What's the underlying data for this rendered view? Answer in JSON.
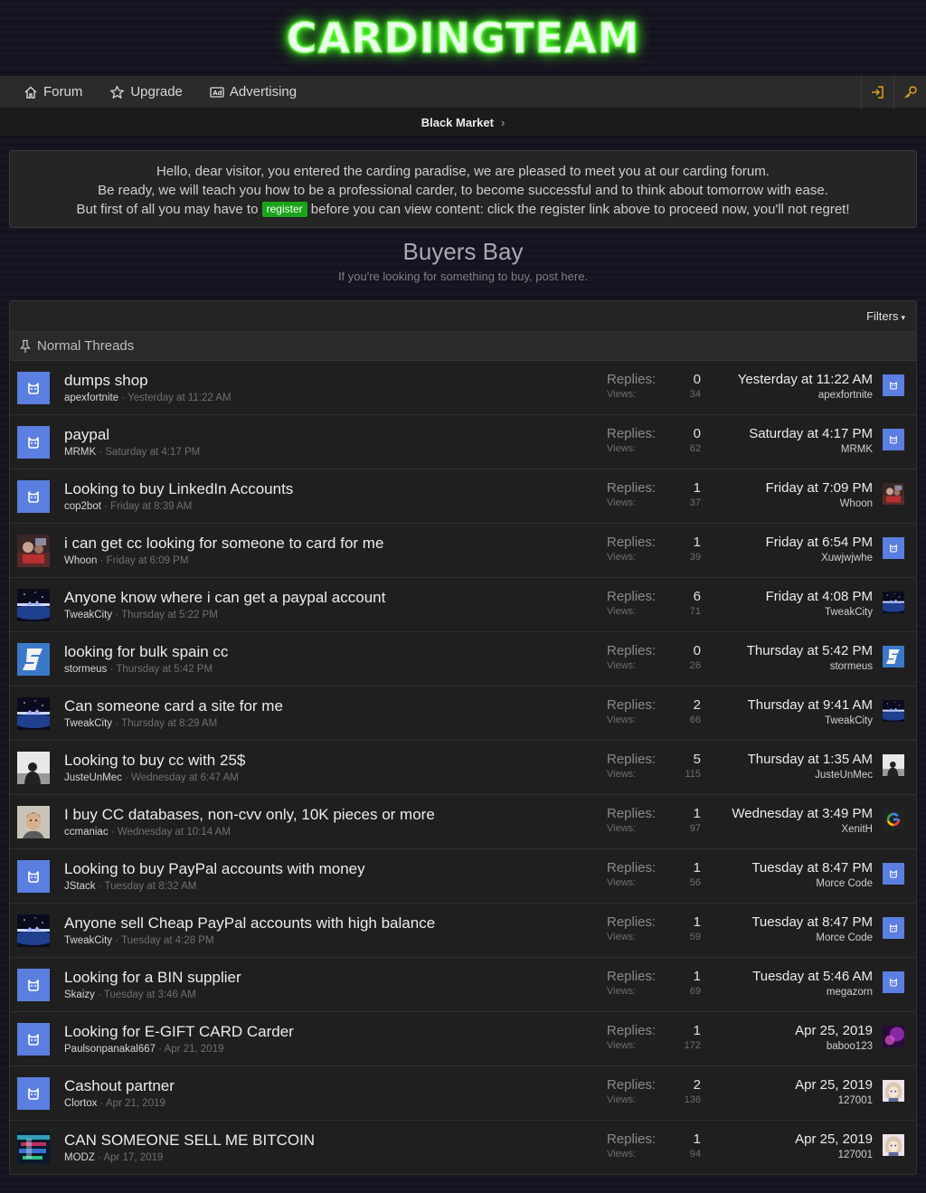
{
  "site": {
    "logo": "CARDINGTEAM"
  },
  "nav": {
    "tabs": [
      {
        "label": "Forum",
        "icon": "home-icon"
      },
      {
        "label": "Upgrade",
        "icon": "star-icon"
      },
      {
        "label": "Advertising",
        "icon": "ad-icon"
      }
    ],
    "actions": [
      "login-icon",
      "key-icon"
    ]
  },
  "subnav": {
    "label": "Black Market",
    "chevron": "›"
  },
  "notice": {
    "line1": "Hello, dear visitor, you entered the carding paradise, we are pleased to meet you at our carding forum.",
    "line2": "Be ready, we will teach you how to be a professional carder, to become successful and to think about tomorrow with ease.",
    "line3_before": "But first of all you may have to",
    "register_label": "register",
    "line3_after": "before you can view content: click the register link above to proceed now, you'll not regret!"
  },
  "forum": {
    "title": "Buyers Bay",
    "description": "If you're looking for something to buy, post here."
  },
  "filters": {
    "label": "Filters",
    "caret": "▾"
  },
  "section": {
    "label": "Normal Threads",
    "icon": "pin-icon"
  },
  "labels": {
    "replies": "Replies:",
    "views": "Views:"
  },
  "colors": {
    "accent_green": "#39ff14",
    "register_bg": "#19a519",
    "avatar_blue": "#5b7fe0",
    "icon_orange": "#e0a020"
  },
  "threads": [
    {
      "title": "dumps shop",
      "author": "apexfortnite",
      "started": "Yesterday at 11:22 AM",
      "replies": "0",
      "views": "34",
      "last_date": "Yesterday at 11:22 AM",
      "last_user": "apexfortnite",
      "avatar": "default",
      "last_avatar": "default"
    },
    {
      "title": "paypal",
      "author": "MRMK",
      "started": "Saturday at 4:17 PM",
      "replies": "0",
      "views": "62",
      "last_date": "Saturday at 4:17 PM",
      "last_user": "MRMK",
      "avatar": "default",
      "last_avatar": "default"
    },
    {
      "title": "Looking to buy LinkedIn Accounts",
      "author": "cop2bot",
      "started": "Friday at 8:39 AM",
      "replies": "1",
      "views": "37",
      "last_date": "Friday at 7:09 PM",
      "last_user": "Whoon",
      "avatar": "default",
      "last_avatar": "photo-red"
    },
    {
      "title": "i can get cc looking for someone to card for me",
      "author": "Whoon",
      "started": "Friday at 6:09 PM",
      "replies": "1",
      "views": "39",
      "last_date": "Friday at 6:54 PM",
      "last_user": "Xuwjwjwhe",
      "avatar": "photo-red",
      "last_avatar": "default"
    },
    {
      "title": "Anyone know where i can get a paypal account",
      "author": "TweakCity",
      "started": "Thursday at 5:22 PM",
      "replies": "6",
      "views": "71",
      "last_date": "Friday at 4:08 PM",
      "last_user": "TweakCity",
      "avatar": "space",
      "last_avatar": "space"
    },
    {
      "title": "looking for bulk spain cc",
      "author": "stormeus",
      "started": "Thursday at 5:42 PM",
      "replies": "0",
      "views": "26",
      "last_date": "Thursday at 5:42 PM",
      "last_user": "stormeus",
      "avatar": "s-logo",
      "last_avatar": "s-logo"
    },
    {
      "title": "Can someone card a site for me",
      "author": "TweakCity",
      "started": "Thursday at 8:29 AM",
      "replies": "2",
      "views": "66",
      "last_date": "Thursday at 9:41 AM",
      "last_user": "TweakCity",
      "avatar": "space",
      "last_avatar": "space"
    },
    {
      "title": "Looking to buy cc with 25$",
      "author": "JusteUnMec",
      "started": "Wednesday at 6:47 AM",
      "replies": "5",
      "views": "115",
      "last_date": "Thursday at 1:35 AM",
      "last_user": "JusteUnMec",
      "avatar": "silhouette",
      "last_avatar": "silhouette"
    },
    {
      "title": "I buy CC databases, non-cvv only, 10K pieces or more",
      "author": "ccmaniac",
      "started": "Wednesday at 10:14 AM",
      "replies": "1",
      "views": "97",
      "last_date": "Wednesday at 3:49 PM",
      "last_user": "XenitH",
      "avatar": "face",
      "last_avatar": "google"
    },
    {
      "title": "Looking to buy PayPal accounts with money",
      "author": "JStack",
      "started": "Tuesday at 8:32 AM",
      "replies": "1",
      "views": "56",
      "last_date": "Tuesday at 8:47 PM",
      "last_user": "Morce Code",
      "avatar": "default",
      "last_avatar": "default"
    },
    {
      "title": "Anyone sell Cheap PayPal accounts with high balance",
      "author": "TweakCity",
      "started": "Tuesday at 4:28 PM",
      "replies": "1",
      "views": "59",
      "last_date": "Tuesday at 8:47 PM",
      "last_user": "Morce Code",
      "avatar": "space",
      "last_avatar": "default"
    },
    {
      "title": "Looking for a BIN supplier",
      "author": "Skaizy",
      "started": "Tuesday at 3:46 AM",
      "replies": "1",
      "views": "69",
      "last_date": "Tuesday at 5:46 AM",
      "last_user": "megazorn",
      "avatar": "default",
      "last_avatar": "default"
    },
    {
      "title": "Looking for E-GIFT CARD Carder",
      "author": "Paulsonpanakal667",
      "started": "Apr 21, 2019",
      "replies": "1",
      "views": "172",
      "last_date": "Apr 25, 2019",
      "last_user": "baboo123",
      "avatar": "default",
      "last_avatar": "purple"
    },
    {
      "title": "Cashout partner",
      "author": "Clortox",
      "started": "Apr 21, 2019",
      "replies": "2",
      "views": "136",
      "last_date": "Apr 25, 2019",
      "last_user": "127001",
      "avatar": "default",
      "last_avatar": "anime"
    },
    {
      "title": "CAN SOMEONE SELL ME BITCOIN",
      "author": "MODZ",
      "started": "Apr 17, 2019",
      "replies": "1",
      "views": "94",
      "last_date": "Apr 25, 2019",
      "last_user": "127001",
      "avatar": "glitch",
      "last_avatar": "anime"
    }
  ]
}
